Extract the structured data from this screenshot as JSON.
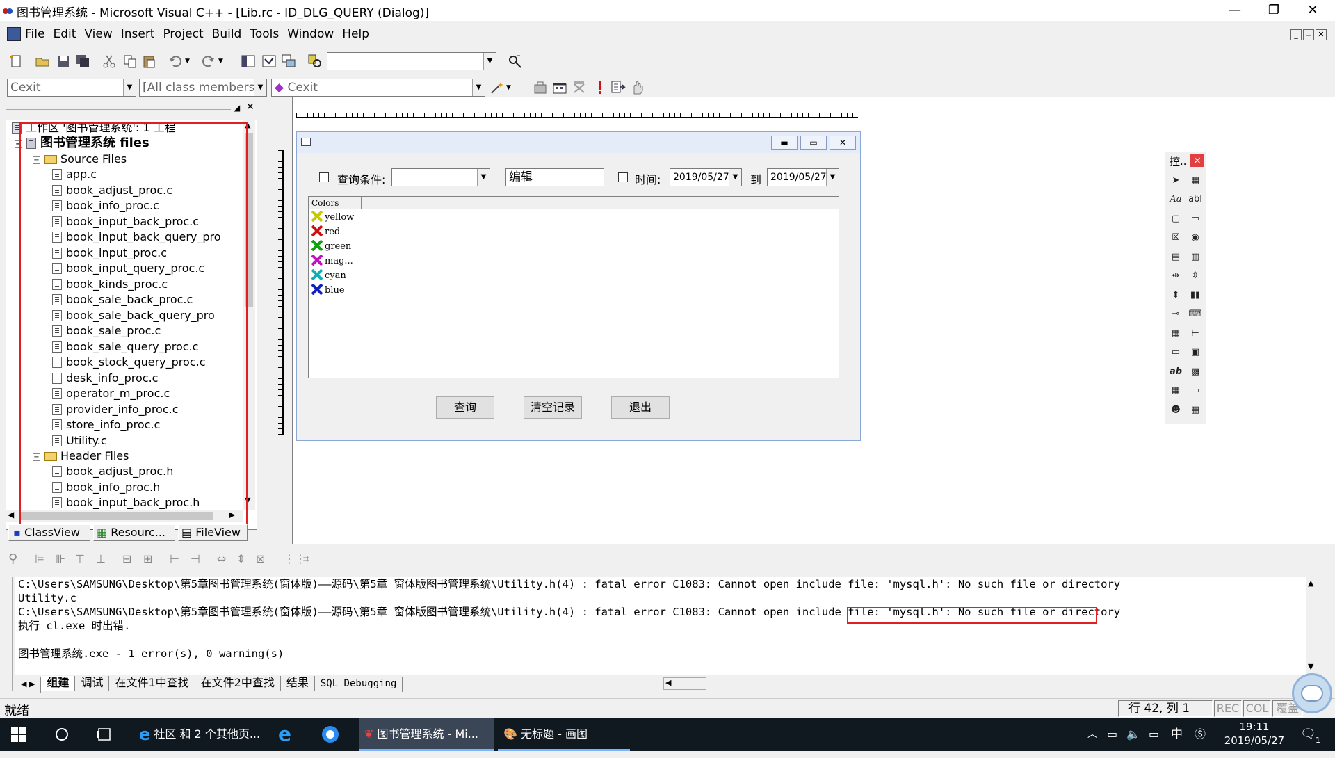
{
  "window": {
    "title": "图书管理系统 - Microsoft Visual C++ - [Lib.rc - ID_DLG_QUERY (Dialog)]",
    "controls": [
      "—",
      "❐",
      "✕"
    ]
  },
  "menu": [
    "File",
    "Edit",
    "View",
    "Insert",
    "Project",
    "Build",
    "Tools",
    "Window",
    "Help"
  ],
  "toolbar2": {
    "class_combo": "Cexit",
    "members_combo": "[All class members]",
    "function_combo": "Cexit"
  },
  "workspace": {
    "root": "工作区 '图书管理系统': 1 工程",
    "project": "图书管理系统 files",
    "source_folder": "Source Files",
    "source_files": [
      "app.c",
      "book_adjust_proc.c",
      "book_info_proc.c",
      "book_input_back_proc.c",
      "book_input_back_query_pro",
      "book_input_proc.c",
      "book_input_query_proc.c",
      "book_kinds_proc.c",
      "book_sale_back_proc.c",
      "book_sale_back_query_pro",
      "book_sale_proc.c",
      "book_sale_query_proc.c",
      "book_stock_query_proc.c",
      "desk_info_proc.c",
      "operator_m_proc.c",
      "provider_info_proc.c",
      "store_info_proc.c",
      "Utility.c"
    ],
    "header_folder": "Header Files",
    "header_files": [
      "book_adjust_proc.h",
      "book_info_proc.h",
      "book_input_back_proc.h"
    ],
    "tabs": [
      "ClassView",
      "Resourc...",
      "FileView"
    ]
  },
  "dialog": {
    "cond_label": "查询条件:",
    "edit_text": "编辑",
    "time_label": "时间:",
    "date_from": "2019/05/27",
    "to_label": "到",
    "date_to": "2019/05/27",
    "list_header": "Colors",
    "list_items": [
      {
        "label": "yellow",
        "color": "#c8c800"
      },
      {
        "label": "red",
        "color": "#d01010"
      },
      {
        "label": "green",
        "color": "#10a010"
      },
      {
        "label": "mag...",
        "color": "#c010c0"
      },
      {
        "label": "cyan",
        "color": "#10b0b0"
      },
      {
        "label": "blue",
        "color": "#1020c0"
      }
    ],
    "buttons": [
      "查询",
      "清空记录",
      "退出"
    ]
  },
  "palette": {
    "title": "控..",
    "close": "×"
  },
  "output": {
    "lines": [
      "C:\\Users\\SAMSUNG\\Desktop\\第5章图书管理系统(窗体版)——源码\\第5章  窗体版图书管理系统\\Utility.h(4) : fatal error C1083: Cannot open include file: 'mysql.h': No such file or directory",
      "Utility.c",
      "C:\\Users\\SAMSUNG\\Desktop\\第5章图书管理系统(窗体版)——源码\\第5章  窗体版图书管理系统\\Utility.h(4) : fatal error C1083: Cannot open include file: 'mysql.h': No such file or directory",
      "执行 cl.exe 时出错.",
      "",
      "图书管理系统.exe - 1 error(s), 0 warning(s)"
    ],
    "tabs": [
      "组建",
      "调试",
      "在文件1中查找",
      "在文件2中查找",
      "结果",
      "SQL Debugging"
    ]
  },
  "status": {
    "text": "就绪",
    "position": "行 42, 列 1",
    "indicators": [
      "REC",
      "COL",
      "覆盖"
    ]
  },
  "taskbar": {
    "items": [
      "社区 和 2 个其他页...",
      "图书管理系统 - Mi...",
      "无标题 - 画图"
    ],
    "time": "19:11",
    "date": "2019/05/27",
    "ime": "中",
    "notification_count": "1"
  }
}
